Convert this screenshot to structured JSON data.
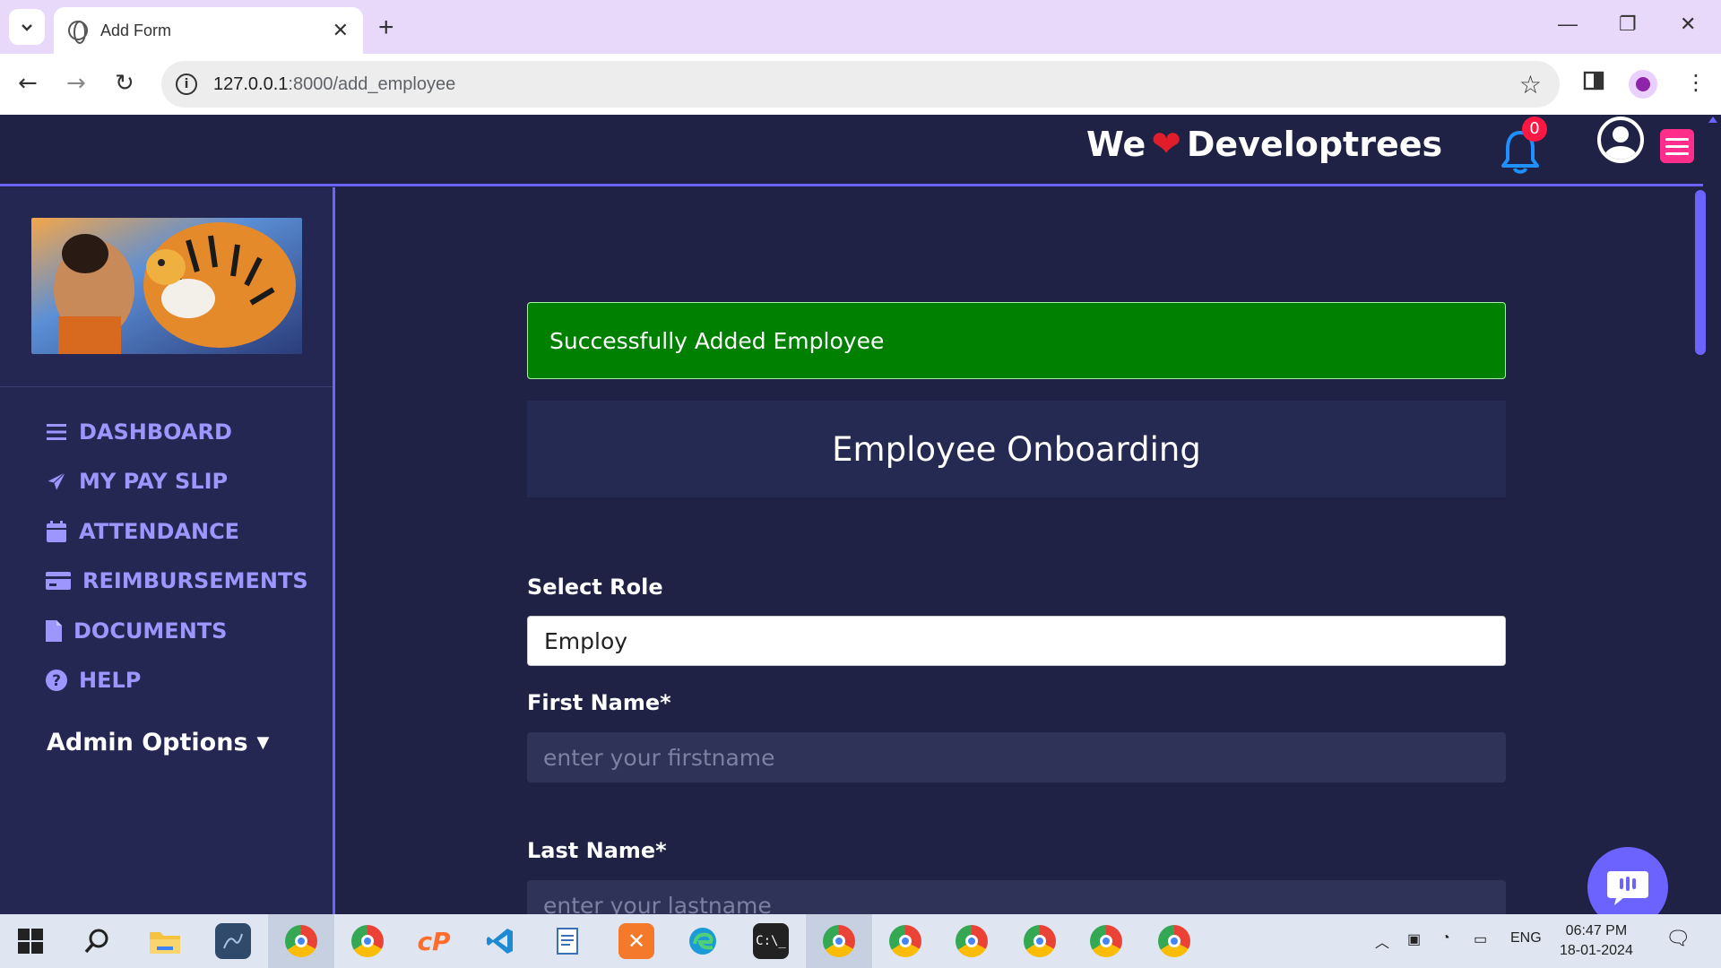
{
  "browser": {
    "tab_title": "Add Form",
    "url_host": "127.0.0.1",
    "url_path": ":8000/add_employee"
  },
  "header": {
    "brand_left": "We",
    "brand_right": "Developtrees",
    "notification_count": "0"
  },
  "sidebar": {
    "items": [
      {
        "label": "DASHBOARD",
        "icon": "bars-icon"
      },
      {
        "label": "MY PAY SLIP",
        "icon": "paper-plane-icon"
      },
      {
        "label": "ATTENDANCE",
        "icon": "calendar-icon"
      },
      {
        "label": "REIMBURSEMENTS",
        "icon": "credit-card-icon"
      },
      {
        "label": "DOCUMENTS",
        "icon": "file-icon"
      },
      {
        "label": "HELP",
        "icon": "question-circle-icon"
      }
    ],
    "admin_options": "Admin Options"
  },
  "main": {
    "alert": "Successfully Added Employee",
    "panel_title": "Employee Onboarding",
    "select_role_label": "Select Role",
    "select_role_value": "Employ",
    "first_name_label": "First Name*",
    "first_name_placeholder": "enter your firstname",
    "last_name_label": "Last Name*",
    "last_name_placeholder": "enter your lastname"
  },
  "taskbar": {
    "language": "ENG",
    "time": "06:47 PM",
    "date": "18-01-2024"
  },
  "colors": {
    "accent": "#6c63ff",
    "success": "#008000",
    "background": "#1f2244",
    "sidebar_text": "#9d96ff"
  }
}
